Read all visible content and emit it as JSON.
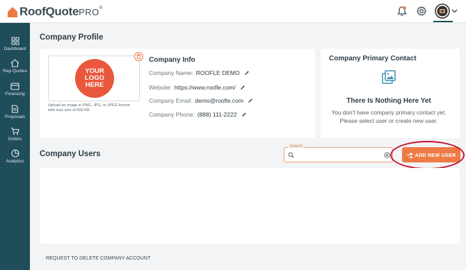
{
  "app": {
    "brand": "RoofQuote",
    "brand_suffix": "PRO",
    "trademark": "®"
  },
  "sidebar": {
    "items": [
      {
        "label": "Dashboard",
        "icon": "grid-icon"
      },
      {
        "label": "Rep Quotes",
        "icon": "house-icon"
      },
      {
        "label": "Financing",
        "icon": "credit-card-icon"
      },
      {
        "label": "Proposals",
        "icon": "document-icon"
      },
      {
        "label": "Orders",
        "icon": "cart-icon"
      },
      {
        "label": "Analytics",
        "icon": "pie-chart-icon"
      }
    ]
  },
  "profile": {
    "title": "Company Profile",
    "logo_placeholder": "YOUR LOGO HERE",
    "upload_note": "Upload an image in PNG, JPG, or JPEG format with max size of 500 KB"
  },
  "company_info": {
    "title": "Company Info",
    "rows": [
      {
        "label": "Company Name:",
        "value": "ROOFLE DEMO"
      },
      {
        "label": "Website:",
        "value": "https://www.roofle.com/"
      },
      {
        "label": "Company Email:",
        "value": "demo@roofle.com"
      },
      {
        "label": "Company Phone:",
        "value": "(888) 111-2222"
      }
    ]
  },
  "primary_contact": {
    "title": "Company Primary Contact",
    "empty_title": "There Is Nothing Here Yet",
    "empty_text": "You don't have company primary contact yet. Please select user or create new user."
  },
  "users": {
    "title": "Company Users",
    "search_label": "Search",
    "search_value": "",
    "add_button": "ADD NEW USER"
  },
  "footer": {
    "delete_link": "REQUEST TO DELETE COMPANY ACCOUNT"
  },
  "colors": {
    "sidebar": "#1f4d59",
    "accent": "#ee7b46",
    "highlight": "#c8102e"
  }
}
